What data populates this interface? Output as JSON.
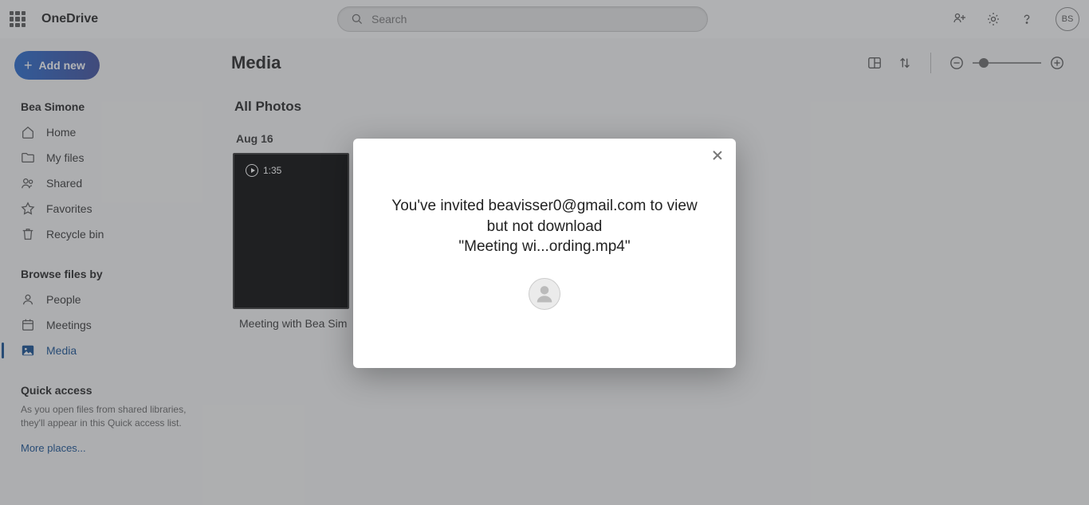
{
  "header": {
    "app_name": "OneDrive",
    "search_placeholder": "Search",
    "avatar_initials": "BS"
  },
  "sidebar": {
    "add_new": "Add new",
    "user_section": "Bea Simone",
    "nav1": [
      {
        "label": "Home"
      },
      {
        "label": "My files"
      },
      {
        "label": "Shared"
      },
      {
        "label": "Favorites"
      },
      {
        "label": "Recycle bin"
      }
    ],
    "browse_section": "Browse files by",
    "nav2": [
      {
        "label": "People"
      },
      {
        "label": "Meetings"
      },
      {
        "label": "Media"
      }
    ],
    "quick_access_title": "Quick access",
    "quick_access_desc": "As you open files from shared libraries, they'll appear in this Quick access list.",
    "more_places": "More places..."
  },
  "main": {
    "title": "Media",
    "section": "All Photos",
    "date": "Aug 16",
    "video_duration": "1:35",
    "video_name": "Meeting with Bea Sim"
  },
  "modal": {
    "line1": "You've invited beavisser0@gmail.com to view",
    "line2": "but not download",
    "line3": "\"Meeting wi...ording.mp4\""
  }
}
